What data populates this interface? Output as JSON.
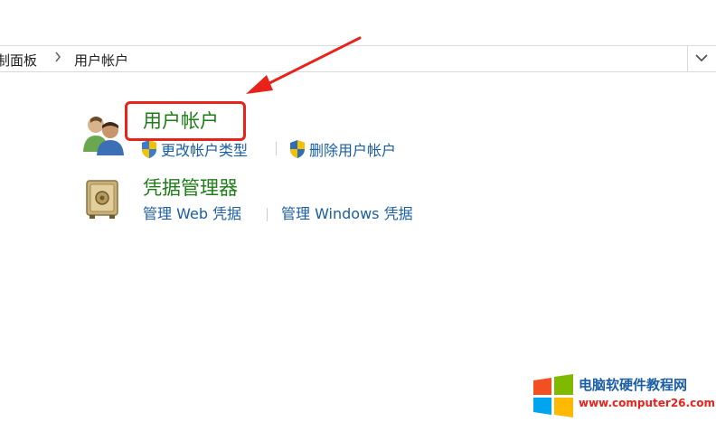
{
  "address_bar": {
    "crumb_parent": "制面板",
    "crumb_current": "用户帐户",
    "separator_icon": "chevron-right-icon",
    "dropdown_icon": "chevron-down-icon"
  },
  "categories": [
    {
      "icon": "users-icon",
      "title": "用户帐户",
      "tasks": [
        {
          "label": "更改帐户类型",
          "icon": "uac-shield-icon"
        },
        {
          "label": "删除用户帐户",
          "icon": "uac-shield-icon"
        }
      ]
    },
    {
      "icon": "vault-icon",
      "title": "凭据管理器",
      "tasks": [
        {
          "label": "管理 Web 凭据"
        },
        {
          "label": "管理 Windows 凭据"
        }
      ]
    }
  ],
  "colors": {
    "category_title": "#1e7d17",
    "task_link": "#1a5ea5",
    "annotation": "#e8231b"
  },
  "watermark": {
    "logo": "windows-logo-icon",
    "title": "电脑软硬件教程网",
    "url": "www.computer26.com"
  }
}
